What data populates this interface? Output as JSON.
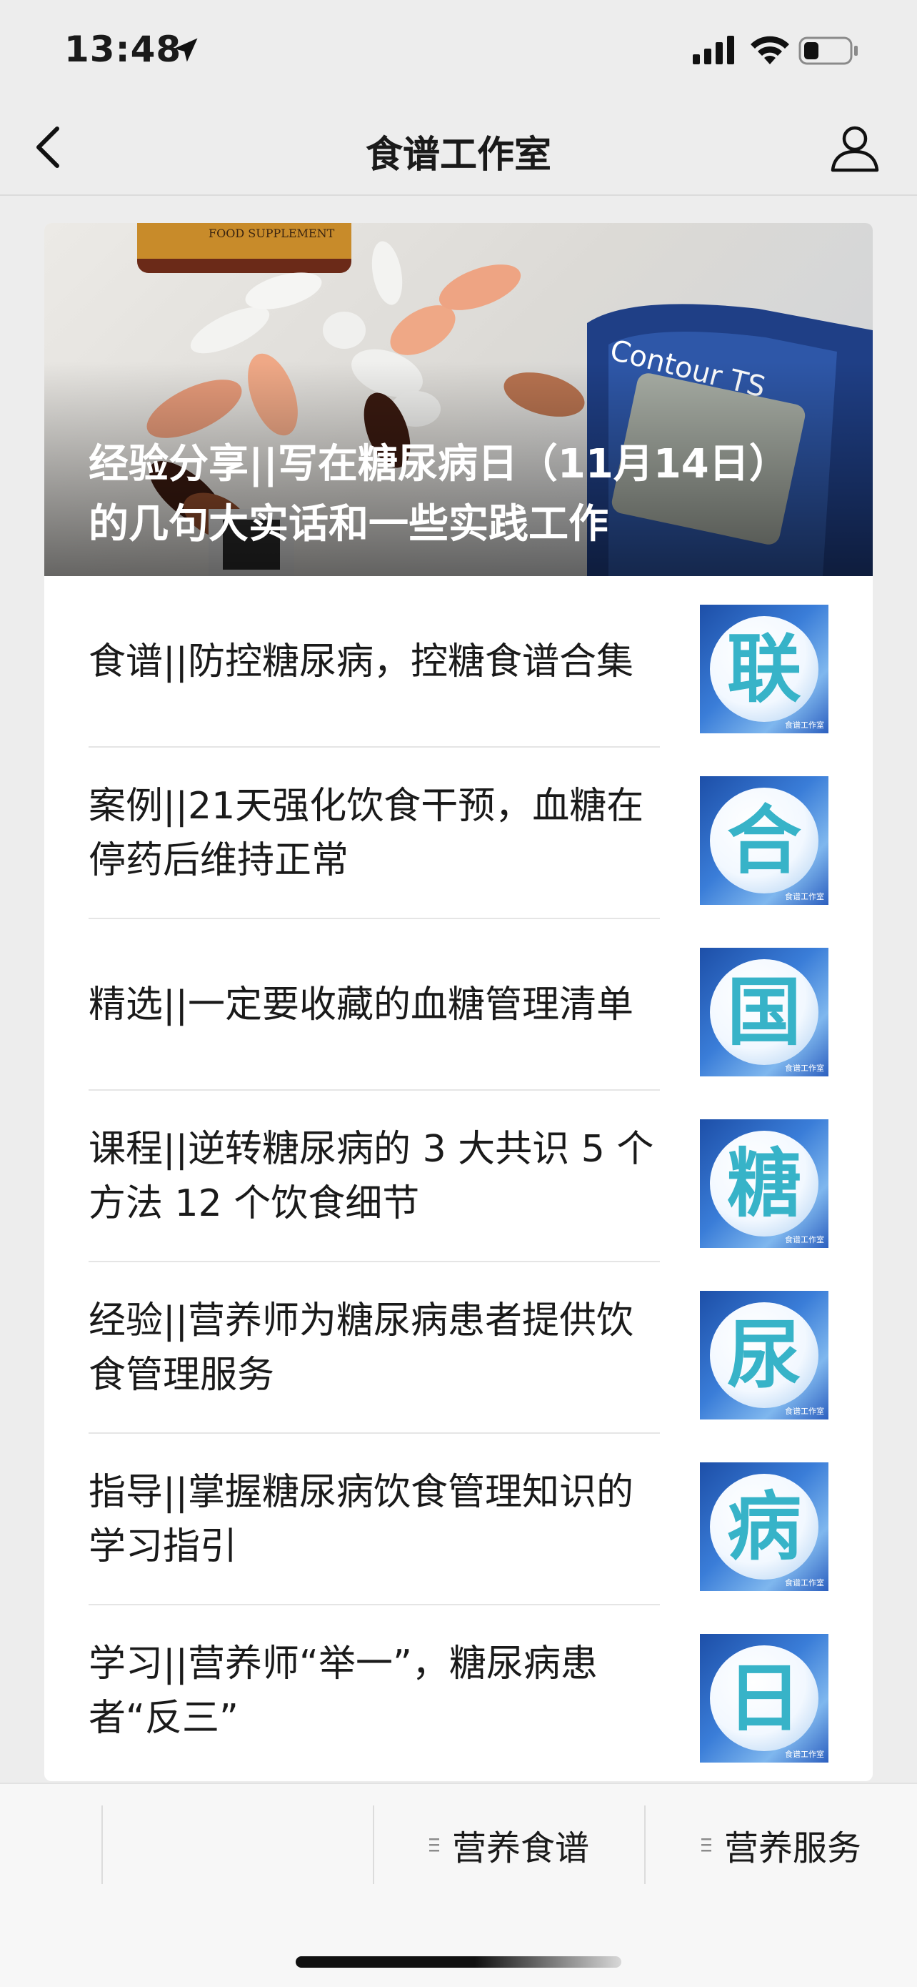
{
  "status_bar": {
    "time": "13:48"
  },
  "nav": {
    "title": "食谱工作室"
  },
  "hero": {
    "title": "经验分享||写在糖尿病日（11月14日）的几句大实话和一些实践工作",
    "image_text_meter": "Contour TS",
    "image_text_bottle": "FOOD SUPPLEMENT"
  },
  "articles": [
    {
      "title": "食谱||防控糖尿病，控糖食谱合集",
      "thumb_char": "联"
    },
    {
      "title": "案例||21天强化饮食干预，血糖在停药后维持正常",
      "thumb_char": "合"
    },
    {
      "title": "精选||一定要收藏的血糖管理清单",
      "thumb_char": "国"
    },
    {
      "title": "课程||逆转糖尿病的 3 大共识 5 个方法 12 个饮食细节",
      "thumb_char": "糖"
    },
    {
      "title": "经验||营养师为糖尿病患者提供饮食管理服务",
      "thumb_char": "尿"
    },
    {
      "title": "指导||掌握糖尿病饮食管理知识的学习指引",
      "thumb_char": "病"
    },
    {
      "title": "学习||营养师“举一”，糖尿病患者“反三”",
      "thumb_char": "日"
    }
  ],
  "thumb_watermark": "食谱工作室",
  "tab_bar": {
    "tabs": [
      {
        "label": "营养食谱"
      },
      {
        "label": "营养服务"
      }
    ]
  },
  "colors": {
    "thumb_char": "#37b3c8",
    "thumb_bg": "#2c5fbf",
    "background": "#ededed"
  }
}
